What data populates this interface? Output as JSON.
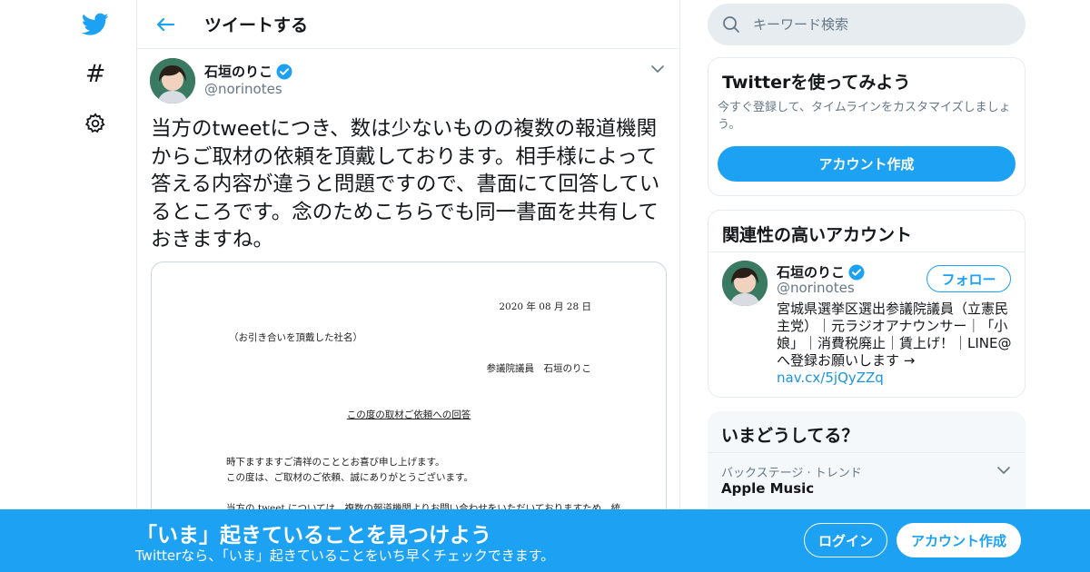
{
  "colors": {
    "brand": "#1da1f2",
    "text": "#14171a",
    "muted": "#657786",
    "border": "#e6ecf0",
    "link": "#1b95e0"
  },
  "rail": {
    "icons": [
      "twitter-bird-icon",
      "hashtag-icon",
      "gear-icon"
    ],
    "explore_glyph": "#"
  },
  "header": {
    "title": "ツイートする"
  },
  "tweet": {
    "author_name": "石垣のりこ",
    "author_handle": "@norinotes",
    "verified": true,
    "text": "当方のtweetにつき、数は少ないものの複数の報道機関からご取材の依頼を頂戴しております。相手様によって答える内容が違うと問題ですので、書面にて回答しているところです。念のためこちらでも同一書面を共有しておきますね。",
    "document": {
      "date": "2020 年 08 月 28 日",
      "recipient": "（お引き合いを頂戴した社名）",
      "sender": "参議院議員　石垣のりこ",
      "subject": "この度の取材ご依頼への回答",
      "line1": "時下ますますご清祥のこととお喜び申し上げます。",
      "line2": "この度は、ご取材のご依頼、誠にありがとうございます。",
      "line3": "当方の tweet については、複数の報道機関よりお問い合わせをいただいておりますため、統"
    }
  },
  "search": {
    "placeholder": "キーワード検索"
  },
  "signup_card": {
    "title": "Twitterを使ってみよう",
    "subtitle": "今すぐ登録して、タイムラインをカスタマイズしましょう。",
    "button": "アカウント作成"
  },
  "related_card": {
    "title": "関連性の高いアカウント",
    "name": "石垣のりこ",
    "handle": "@norinotes",
    "follow": "フォロー",
    "bio": "宮城県選挙区選出参議院議員（立憲民主党）｜元ラジオアナウンサー｜「小娘」｜消費税廃止｜賃上げ！｜LINE@へ登録お願いします →",
    "link": "nav.cx/5jQyZZq"
  },
  "trends_card": {
    "title": "いまどうしてる？",
    "trend_meta": "バックステージ · トレンド",
    "trend_name": "Apple Music"
  },
  "banner": {
    "title": "「いま」起きていることを見つけよう",
    "subtitle": "Twitterなら、「いま」起きていることをいち早くチェックできます。",
    "login": "ログイン",
    "signup": "アカウント作成"
  }
}
